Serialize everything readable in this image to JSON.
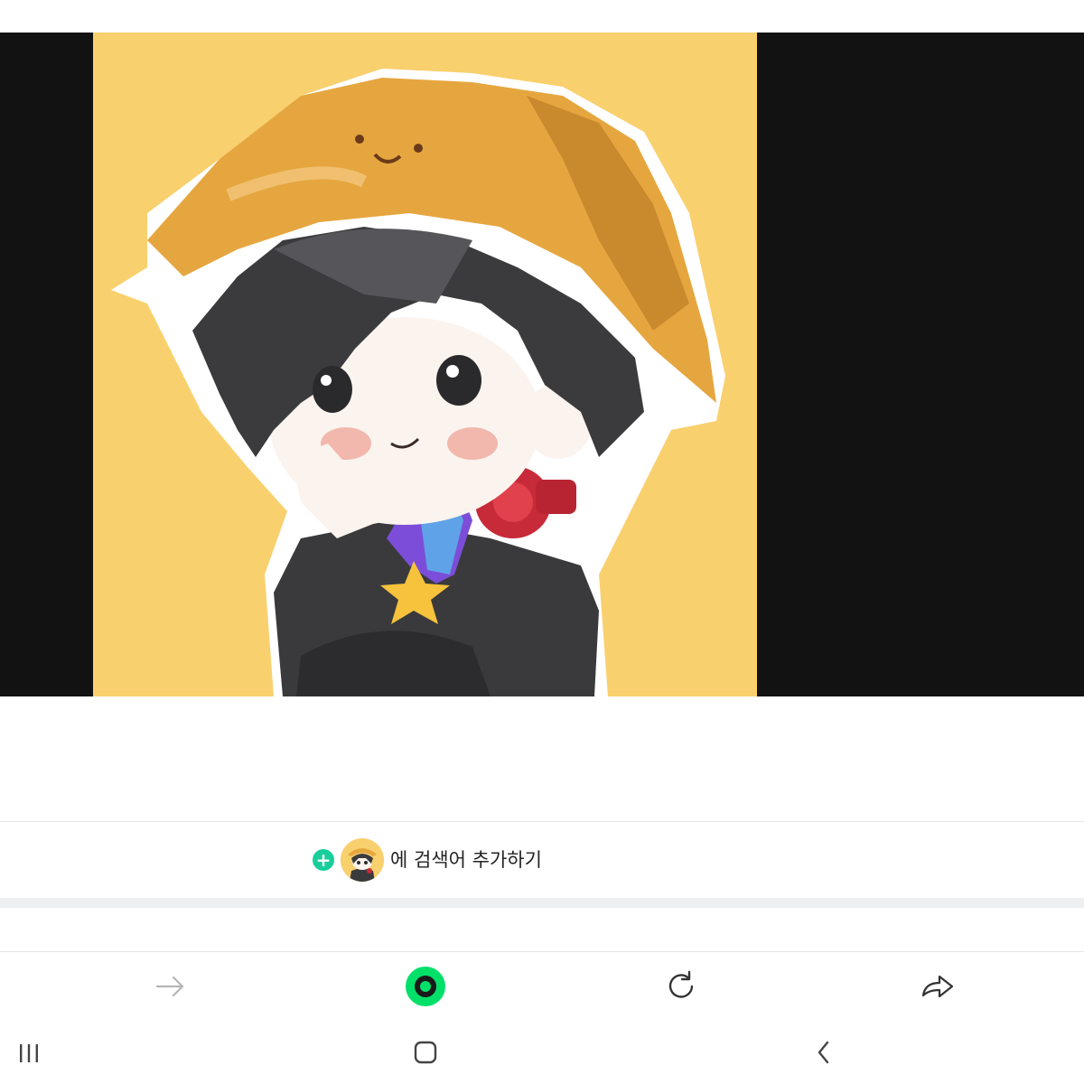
{
  "image_viewer": {
    "artwork": "chibi-character-yellow-bucket-hat",
    "background_color": "#f9d06e",
    "frame_color": "#121212"
  },
  "add_search_term": {
    "plus_icon": "plus-circle-icon",
    "avatar": "character-avatar",
    "label": "에 검색어 추가하기",
    "accent_color": "#19ce9b"
  },
  "browser_toolbar": {
    "forward_icon": "arrow-right-icon",
    "home_icon": "green-circle-home-icon",
    "refresh_icon": "refresh-icon",
    "share_icon": "share-arrow-icon",
    "brand_color": "#03e06a"
  },
  "system_nav": {
    "recents_icon": "recents-icon",
    "home_icon": "home-square-icon",
    "back_icon": "chevron-left-icon"
  }
}
